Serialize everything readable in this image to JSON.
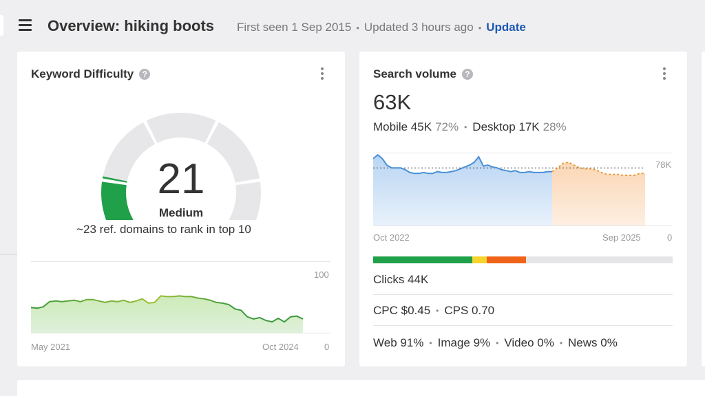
{
  "header": {
    "title": "Overview: hiking boots",
    "first_seen": "First seen 1 Sep 2015",
    "updated": "Updated 3 hours ago",
    "update_label": "Update",
    "separator": "•"
  },
  "keyword_difficulty": {
    "title": "Keyword Difficulty",
    "help": "?",
    "value": "21",
    "value_number": 21,
    "level": "Medium",
    "note": "~23 ref. domains to rank in top 10",
    "chart": {
      "x_start": "May 2021",
      "x_end": "Oct 2024",
      "y_max_label": "100",
      "y_min_label": "0",
      "y_max": 100,
      "values": [
        36,
        35,
        37,
        44,
        45,
        44,
        45,
        46,
        44,
        47,
        47,
        45,
        43,
        45,
        44,
        46,
        43,
        45,
        48,
        42,
        43,
        52,
        51,
        51,
        52,
        51,
        51,
        49,
        48,
        46,
        43,
        42,
        40,
        34,
        32,
        23,
        20,
        22,
        18,
        16,
        21,
        16,
        23,
        24,
        20
      ]
    }
  },
  "search_volume": {
    "title": "Search volume",
    "help": "?",
    "total": "63K",
    "mobile_label": "Mobile 45K",
    "mobile_pct": "72%",
    "desktop_label": "Desktop 17K",
    "desktop_pct": "28%",
    "chart": {
      "x_start": "Oct 2022",
      "x_end": "Sep 2025",
      "y_max_label": "78K",
      "y_min_label": "0",
      "y_max": 78,
      "average": 63,
      "history": [
        73,
        77,
        73,
        66,
        63,
        63,
        63,
        61,
        58,
        57,
        57,
        58,
        57,
        57,
        59,
        58,
        58,
        59,
        60,
        62,
        64,
        66,
        69,
        75,
        65,
        66,
        64,
        63,
        61,
        60,
        59,
        60,
        58,
        58,
        59,
        58,
        58,
        58,
        59,
        59
      ],
      "forecast": [
        59,
        63,
        68,
        69,
        66,
        63,
        62,
        62,
        61,
        58,
        56,
        56,
        56,
        55,
        55,
        55,
        57,
        57
      ]
    },
    "intent_bar": [
      {
        "share": 0.33,
        "color": "#21a04a"
      },
      {
        "share": 0.05,
        "color": "#f6d32e"
      },
      {
        "share": 0.13,
        "color": "#f0641a"
      }
    ],
    "clicks": "Clicks 44K",
    "cpc": "CPC $0.45",
    "cps": "CPS 0.70",
    "web": "Web 91%",
    "image": "Image 9%",
    "video": "Video 0%",
    "news": "News 0%"
  },
  "colors": {
    "accent_link": "#1e58b4",
    "gauge_fill": "#21a04a",
    "gauge_track": "#e7e7e9",
    "kd_line": "#3c9a3c",
    "kd_line_high": "#9fbf32",
    "sv_line": "#4a8fd6",
    "forecast_line": "#e89a3e"
  }
}
